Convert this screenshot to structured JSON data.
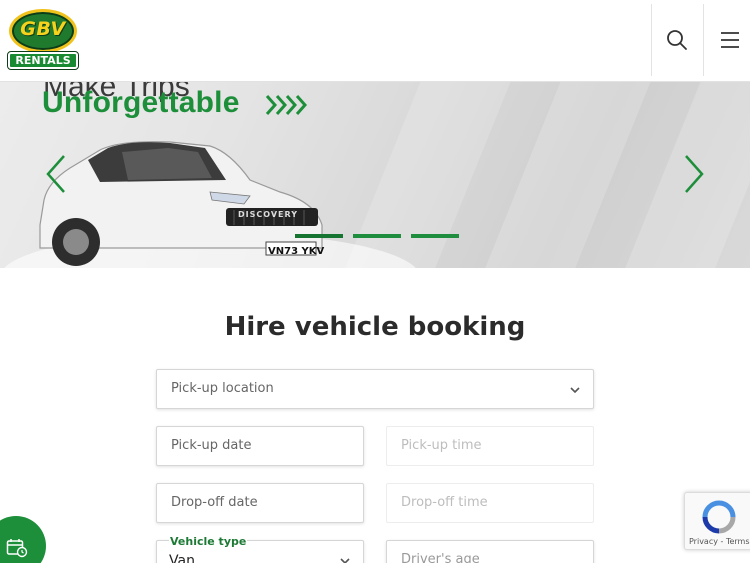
{
  "brand": {
    "logo_top": "GBV",
    "logo_bottom": "RENTALS"
  },
  "header": {
    "search_icon": "search-icon",
    "menu_icon": "hamburger-menu-icon"
  },
  "hero": {
    "headline_top": "Make Trips",
    "headline": "Unforgettable",
    "plate": "VN73 YKV",
    "badge": "DISCOVERY",
    "slides": [
      1,
      2,
      3
    ],
    "prev_icon": "chevron-left-icon",
    "next_icon": "chevron-right-icon"
  },
  "booking": {
    "title": "Hire vehicle booking",
    "pickup_location_placeholder": "Pick-up location",
    "pickup_date_placeholder": "Pick-up date",
    "pickup_time_placeholder": "Pick-up time",
    "dropoff_date_placeholder": "Drop-off date",
    "dropoff_time_placeholder": "Drop-off time",
    "vehicle_type_label": "Vehicle type",
    "vehicle_type_value": "Van",
    "driver_age_placeholder": "Driver's age"
  },
  "recaptcha": {
    "links": "Privacy - Terms"
  },
  "colors": {
    "brand_green": "#1d8f3a",
    "logo_yellow": "#f6d21c"
  }
}
